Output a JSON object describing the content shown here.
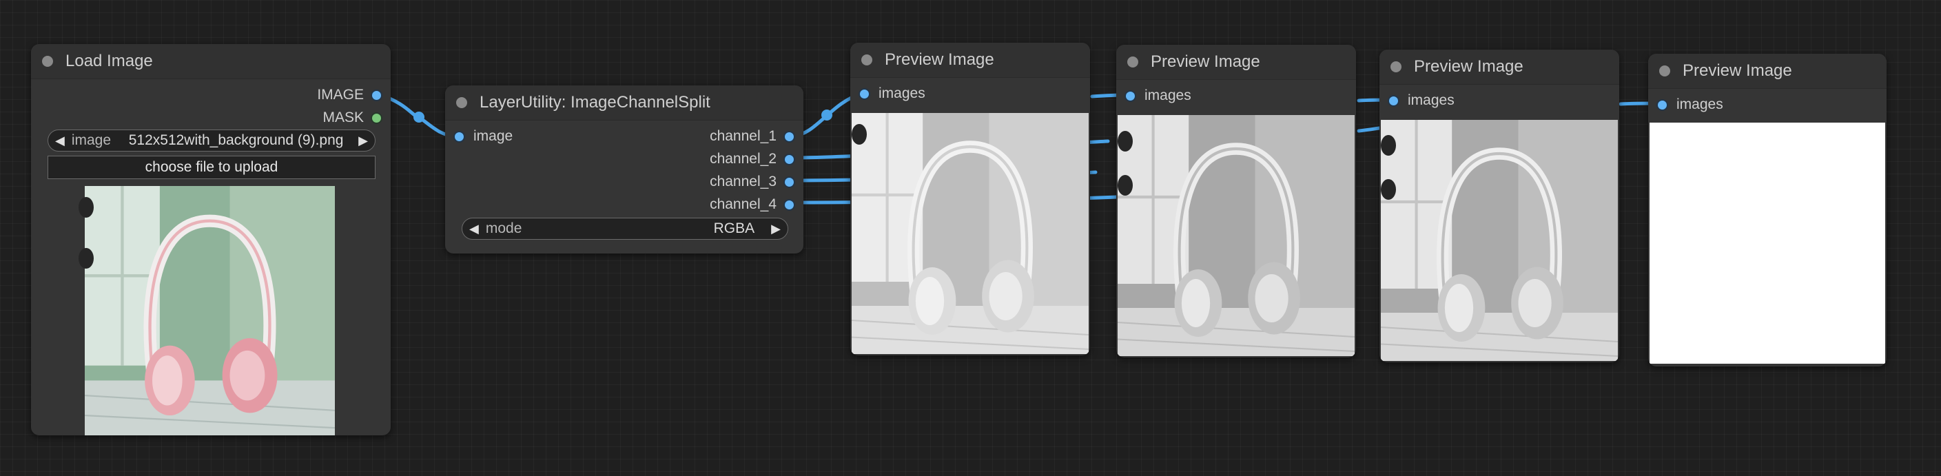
{
  "nodes": {
    "load_image": {
      "title": "Load Image",
      "outputs": [
        "IMAGE",
        "MASK"
      ],
      "image_widget": {
        "label": "image",
        "value": "512x512with_background (9).png"
      },
      "upload_button": "choose file to upload"
    },
    "channel_split": {
      "title": "LayerUtility: ImageChannelSplit",
      "input": "image",
      "outputs": [
        "channel_1",
        "channel_2",
        "channel_3",
        "channel_4"
      ],
      "mode_widget": {
        "label": "mode",
        "value": "RGBA"
      }
    },
    "previews": [
      {
        "title": "Preview Image",
        "input": "images"
      },
      {
        "title": "Preview Image",
        "input": "images"
      },
      {
        "title": "Preview Image",
        "input": "images"
      },
      {
        "title": "Preview Image",
        "input": "images"
      }
    ]
  },
  "icons": {
    "left_arrow": "◀",
    "right_arrow": "▶"
  },
  "colors": {
    "canvas": "#1f1f1f",
    "node_body": "#353535",
    "node_title": "#313131",
    "image_slot": "#64b5f6",
    "mask_slot": "#7ac67a",
    "link": "#4aa3e8"
  }
}
